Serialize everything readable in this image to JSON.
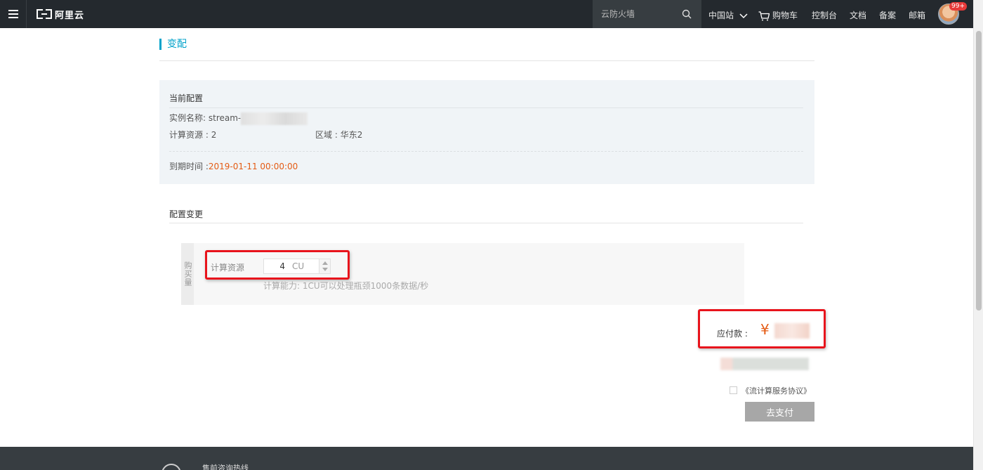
{
  "header": {
    "logo_text": "阿里云",
    "search_placeholder": "云防火墙",
    "region": "中国站",
    "cart": "购物车",
    "console": "控制台",
    "docs": "文档",
    "filing": "备案",
    "mail": "邮箱",
    "notification_count": "99+"
  },
  "page": {
    "title": "变配"
  },
  "current_config": {
    "heading": "当前配置",
    "instance_label": "实例名称:",
    "instance_name_prefix": "stream-",
    "compute_label": "计算资源 :",
    "compute_value": "2",
    "region_label": "区域 :",
    "region_value": "华东2",
    "expire_label": "到期时间 :",
    "expire_value": "2019-01-11 00:00:00"
  },
  "config_change": {
    "heading": "配置变更",
    "side_label": "购买量",
    "compute_label": "计算资源",
    "compute_value": "4",
    "compute_unit": "CU",
    "hint": "计算能力: 1CU可以处理瓶颈1000条数据/秒"
  },
  "payment": {
    "label": "应付款 :",
    "currency": "¥",
    "agreement": "《流计算服务协议》",
    "pay_button": "去支付"
  },
  "footer": {
    "hotline": "售前咨询热线"
  },
  "colors": {
    "accent": "#00a2ca",
    "price": "#e45b14",
    "highlight": "#e8141c",
    "topbar": "#24292e"
  }
}
